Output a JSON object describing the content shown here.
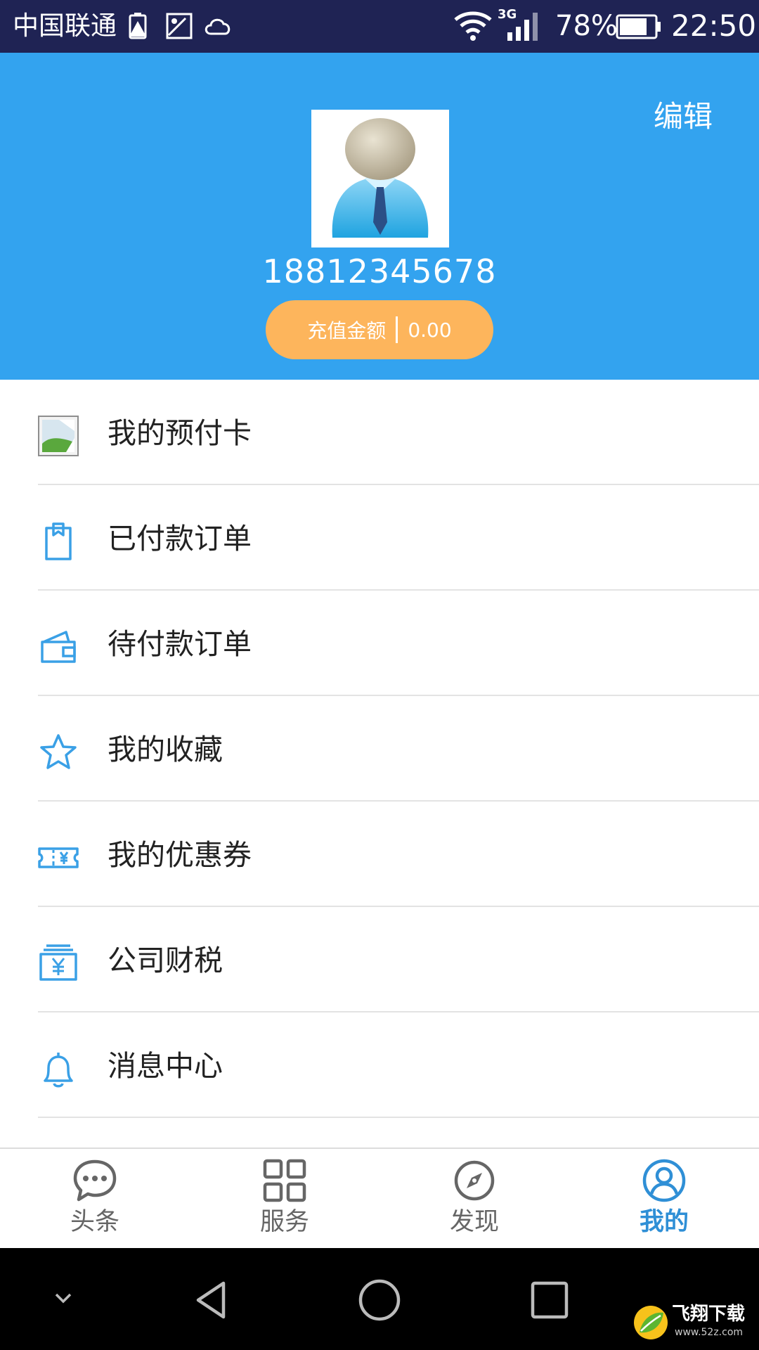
{
  "status_bar": {
    "carrier": "中国联通",
    "network": "3G",
    "battery_percent": "78%",
    "time": "22:50"
  },
  "header": {
    "edit_label": "编辑",
    "phone": "18812345678",
    "recharge_label": "充值金额",
    "recharge_amount": "0.00"
  },
  "menu": {
    "items": [
      {
        "label": "我的预付卡",
        "icon": "image-placeholder-icon"
      },
      {
        "label": "已付款订单",
        "icon": "clipboard-icon"
      },
      {
        "label": "待付款订单",
        "icon": "wallet-icon"
      },
      {
        "label": "我的收藏",
        "icon": "star-icon"
      },
      {
        "label": "我的优惠券",
        "icon": "coupon-icon"
      },
      {
        "label": "公司财税",
        "icon": "yuan-box-icon"
      },
      {
        "label": "消息中心",
        "icon": "bell-icon"
      }
    ]
  },
  "bottom_nav": {
    "items": [
      {
        "label": "头条",
        "icon": "chat-bubble-icon"
      },
      {
        "label": "服务",
        "icon": "grid-icon"
      },
      {
        "label": "发现",
        "icon": "compass-icon"
      },
      {
        "label": "我的",
        "icon": "user-circle-icon",
        "active": true
      }
    ]
  },
  "watermark": {
    "text": "飞翔下载",
    "url_text": "www.52z.com"
  },
  "colors": {
    "status_bar_bg": "#1f2354",
    "header_bg": "#33a3ef",
    "recharge_bg": "#fdb55c",
    "icon_blue": "#3aa0e6",
    "active_nav": "#2f8fd6"
  }
}
